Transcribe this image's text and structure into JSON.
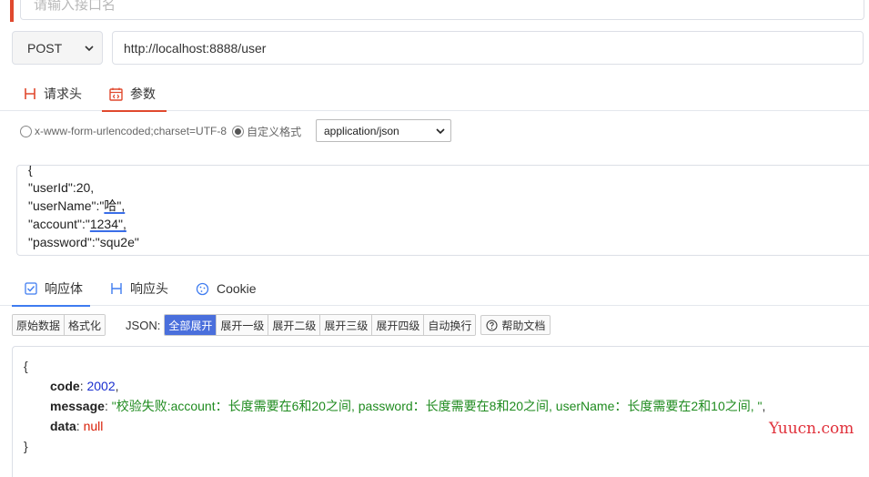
{
  "api_name": {
    "placeholder": "请输入接口名"
  },
  "request": {
    "method": "POST",
    "url": "http://localhost:8888/user",
    "tabs": [
      {
        "label": "请求头",
        "icon": "h-heading-icon"
      },
      {
        "label": "参数",
        "icon": "calendar-code-icon"
      }
    ]
  },
  "content_type": {
    "option_form": "x-www-form-urlencoded;charset=UTF-8",
    "option_custom": "自定义格式",
    "selected_radio": "自定义格式",
    "custom_value": "application/json"
  },
  "body": {
    "lines": [
      {
        "text": "{"
      },
      {
        "text": "\"userId\":20,"
      },
      {
        "pre": "\"userName\":\"",
        "u": "哈\",",
        "post": ""
      },
      {
        "pre": "\"account\":\"",
        "u": "1234\",",
        "post": ""
      },
      {
        "text": "\"password\":\"squ2e\""
      },
      {
        "text": "}"
      }
    ]
  },
  "response": {
    "tabs": [
      {
        "label": "响应体",
        "icon": "checkbox-icon"
      },
      {
        "label": "响应头",
        "icon": "h-heading-icon"
      },
      {
        "label": "Cookie",
        "icon": "cookie-icon"
      }
    ],
    "toolbar": {
      "raw": "原始数据",
      "format": "格式化",
      "json_label": "JSON:",
      "expand_all": "全部展开",
      "expand_1": "展开一级",
      "expand_2": "展开二级",
      "expand_3": "展开三级",
      "expand_4": "展开四级",
      "wrap": "自动换行",
      "help": "帮助文档"
    },
    "json": {
      "open": "{",
      "close": "}",
      "code_key": "code",
      "code_val": "2002",
      "message_key": "message",
      "message_val": "\"校验失败:account：长度需要在6和20之间, password：长度需要在8和20之间, userName：长度需要在2和10之间, \"",
      "data_key": "data",
      "data_val": "null"
    }
  },
  "watermark": "Yuucn.com",
  "colors": {
    "accent_red": "#e0492e",
    "accent_blue": "#3f7cf0",
    "active_button": "#4a6fdc"
  }
}
